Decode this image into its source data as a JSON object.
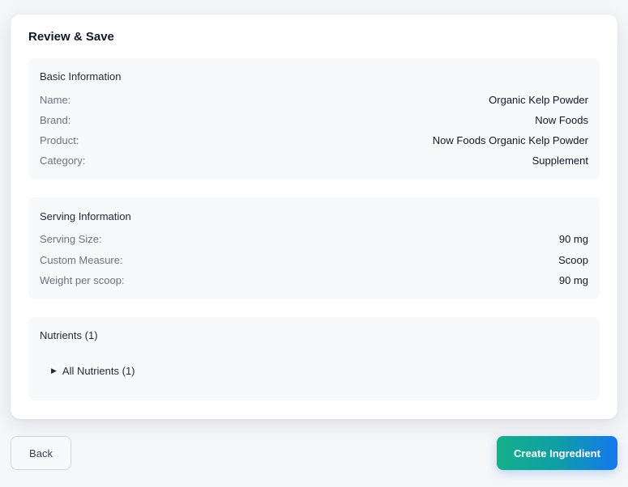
{
  "card": {
    "title": "Review & Save"
  },
  "basic_info": {
    "title": "Basic Information",
    "rows": [
      {
        "label": "Name:",
        "value": "Organic Kelp Powder"
      },
      {
        "label": "Brand:",
        "value": "Now Foods"
      },
      {
        "label": "Product:",
        "value": "Now Foods Organic Kelp Powder"
      },
      {
        "label": "Category:",
        "value": "Supplement"
      }
    ]
  },
  "serving_info": {
    "title": "Serving Information",
    "rows": [
      {
        "label": "Serving Size:",
        "value": "90 mg"
      },
      {
        "label": "Custom Measure:",
        "value": "Scoop"
      },
      {
        "label": "Weight per scoop:",
        "value": "90 mg"
      }
    ]
  },
  "nutrients": {
    "title": "Nutrients (1)",
    "toggle_icon": "triangle-right-icon",
    "toggle_label": "All Nutrients (1)"
  },
  "actions": {
    "back_label": "Back",
    "create_label": "Create Ingredient"
  },
  "colors": {
    "gradient_start": "#14b08a",
    "gradient_end": "#1577ee"
  }
}
